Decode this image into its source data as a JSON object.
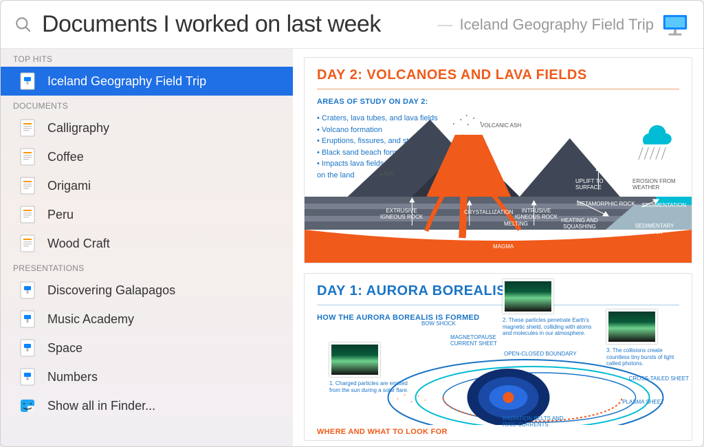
{
  "search": {
    "value": "Documents I worked on last week",
    "breadcrumb_sep": "—",
    "breadcrumb_title": "Iceland Geography Field Trip"
  },
  "sections": {
    "top_hits": {
      "label": "TOP HITS",
      "items": [
        {
          "label": "Iceland Geography Field Trip",
          "icon": "keynote-doc-icon",
          "selected": true
        }
      ]
    },
    "documents": {
      "label": "DOCUMENTS",
      "items": [
        {
          "label": "Calligraphy",
          "icon": "pages-doc-icon"
        },
        {
          "label": "Coffee",
          "icon": "pages-doc-icon"
        },
        {
          "label": "Origami",
          "icon": "pages-doc-icon"
        },
        {
          "label": "Peru",
          "icon": "pages-doc-icon"
        },
        {
          "label": "Wood Craft",
          "icon": "pages-doc-icon"
        }
      ]
    },
    "presentations": {
      "label": "PRESENTATIONS",
      "items": [
        {
          "label": "Discovering Galapagos",
          "icon": "keynote-doc-icon"
        },
        {
          "label": "Music Academy",
          "icon": "keynote-doc-icon"
        },
        {
          "label": "Space",
          "icon": "keynote-doc-icon"
        },
        {
          "label": "Numbers",
          "icon": "keynote-doc-icon"
        }
      ]
    },
    "finder": {
      "label": "Show all in Finder...",
      "icon": "finder-icon"
    }
  },
  "preview": {
    "slide1": {
      "title": "DAY 2: VOLCANOES AND LAVA FIELDS",
      "subhead": "AREAS OF STUDY ON DAY 2:",
      "bullets": [
        "Craters, lava tubes, and lava fields",
        "Volcano formation",
        "Eruptions, fissures, and structure",
        "Black sand beach formation",
        "Impacts lava fields and volcanoes have on the land"
      ],
      "labels": {
        "volcanic_ash": "VOLCANIC ASH",
        "lava": "LAVA",
        "uplift": "UPLIFT TO SURFACE",
        "erosion": "EROSION FROM WEATHER",
        "extrusive": "EXTRUSIVE IGNEOUS ROCK",
        "crystallization": "CRYSTALLIZATION",
        "intrusive": "INTRUSIVE IGNEOUS ROCK",
        "metamorphic": "METAMORPHIC ROCK",
        "sedimentation": "SEDIMENTATION",
        "melting": "MELTING",
        "heating": "HEATING AND SQUASHING",
        "sedimentary": "SEDIMENTARY ROCK",
        "magma": "MAGMA"
      }
    },
    "slide2": {
      "title": "DAY 1: AURORA BOREALIS",
      "subhead": "HOW THE AURORA BOREALIS IS FORMED",
      "captions": {
        "c1": "1. Charged particles are emitted from the sun during a solar flare.",
        "c2": "2. These particles penetrate Earth's magnetic shield, colliding with atoms and molecules in our atmosphere.",
        "c3": "3. The collisions create countless tiny bursts of light called photons."
      },
      "labels": {
        "bow_shock": "BOW SHOCK",
        "magnetopause": "MAGNETOPAUSE CURRENT SHEET",
        "open_closed": "OPEN-CLOSED BOUNDARY",
        "cross_tailed": "CROSS-TAILED SHEET",
        "plasma": "PLASMA SHEET",
        "radiation": "RADIATION BELTS AND RING CURRENTS"
      },
      "bottom": "WHERE AND WHAT TO LOOK FOR"
    }
  }
}
